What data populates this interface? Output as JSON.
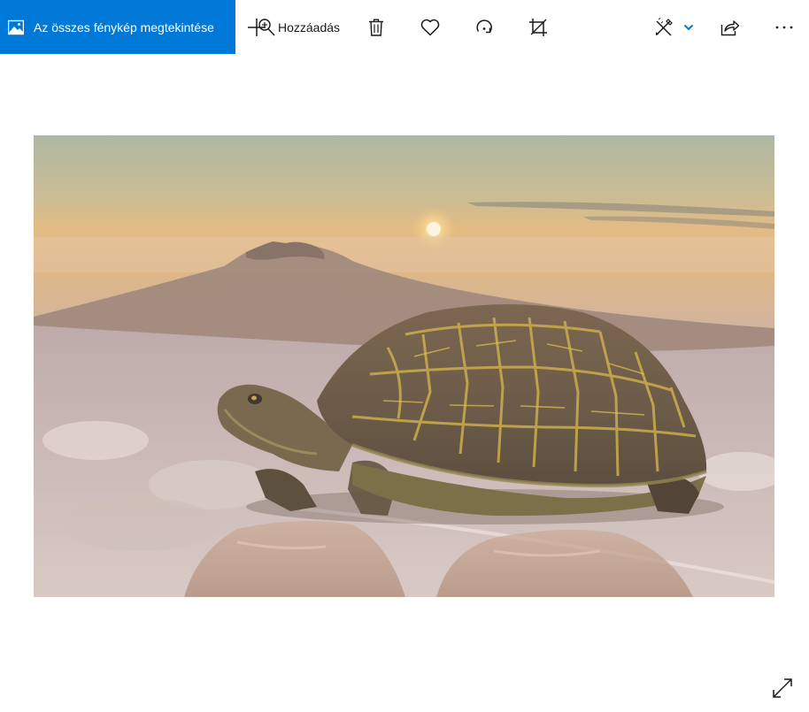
{
  "toolbar": {
    "view_all_label": "Az összes fénykép megtekintése",
    "add_label": "Hozzáadás"
  },
  "colors": {
    "accent": "#0078d7",
    "icon": "#1a1a1a",
    "chevron": "#0078d7"
  },
  "icons": {
    "view_all": "photo-icon",
    "add": "zoom-in-icon",
    "delete": "trash-icon",
    "favorite": "heart-icon",
    "rotate": "rotate-icon",
    "crop": "crop-icon",
    "edit": "edit-create-icon",
    "edit_dropdown": "chevron-down-icon",
    "share": "share-icon",
    "more": "more-icon",
    "fullscreen": "fullscreen-icon"
  },
  "photo": {
    "content": "turtle-on-mountain-composite"
  }
}
